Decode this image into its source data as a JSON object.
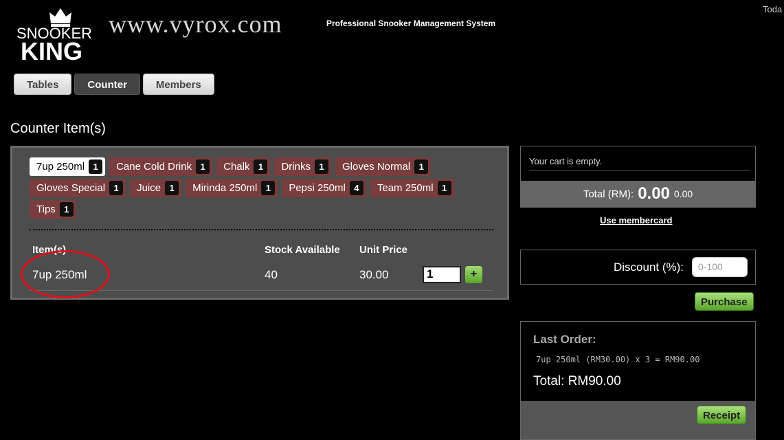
{
  "header": {
    "logo_top": "SNOOKER",
    "logo_bottom": "KING",
    "site_url": "www.vyrox.com",
    "tagline": "Professional Snooker Management System",
    "today": "Toda"
  },
  "nav": {
    "tabs": [
      {
        "label": "Tables",
        "active": false
      },
      {
        "label": "Counter",
        "active": true
      },
      {
        "label": "Members",
        "active": false
      }
    ]
  },
  "counter": {
    "title": "Counter Item(s)",
    "tags": [
      {
        "label": "7up 250ml",
        "count": "1",
        "selected": true
      },
      {
        "label": "Cane Cold Drink",
        "count": "1"
      },
      {
        "label": "Chalk",
        "count": "1"
      },
      {
        "label": "Drinks",
        "count": "1"
      },
      {
        "label": "Gloves Normal",
        "count": "1"
      },
      {
        "label": "Gloves Special",
        "count": "1"
      },
      {
        "label": "Juice",
        "count": "1"
      },
      {
        "label": "Mirinda 250ml",
        "count": "1"
      },
      {
        "label": "Pepsi 250ml",
        "count": "4"
      },
      {
        "label": "Team 250ml",
        "count": "1"
      },
      {
        "label": "Tips",
        "count": "1"
      }
    ],
    "columns": {
      "item": "Item(s)",
      "stock": "Stock Available",
      "price": "Unit Price"
    },
    "row": {
      "item": "7up 250ml",
      "stock": "40",
      "price": "30.00",
      "qty": "1"
    },
    "add_label": "+"
  },
  "cart": {
    "empty_text": "Your cart is empty.",
    "total_label": "Total (RM):",
    "total_big": "0.00",
    "total_small": "0.00",
    "membercard_link": "Use membercard"
  },
  "discount": {
    "label": "Discount (%):",
    "placeholder": "0-100"
  },
  "purchase_label": "Purchase",
  "last_order": {
    "title": "Last Order:",
    "line": "7up 250ml (RM30.00) x 3 = RM90.00",
    "total": "Total: RM90.00",
    "receipt_label": "Receipt"
  },
  "colors": {
    "tag_bg": "#7a3d3d",
    "highlight": "#e0101a",
    "button_green": "#5aa52a"
  }
}
